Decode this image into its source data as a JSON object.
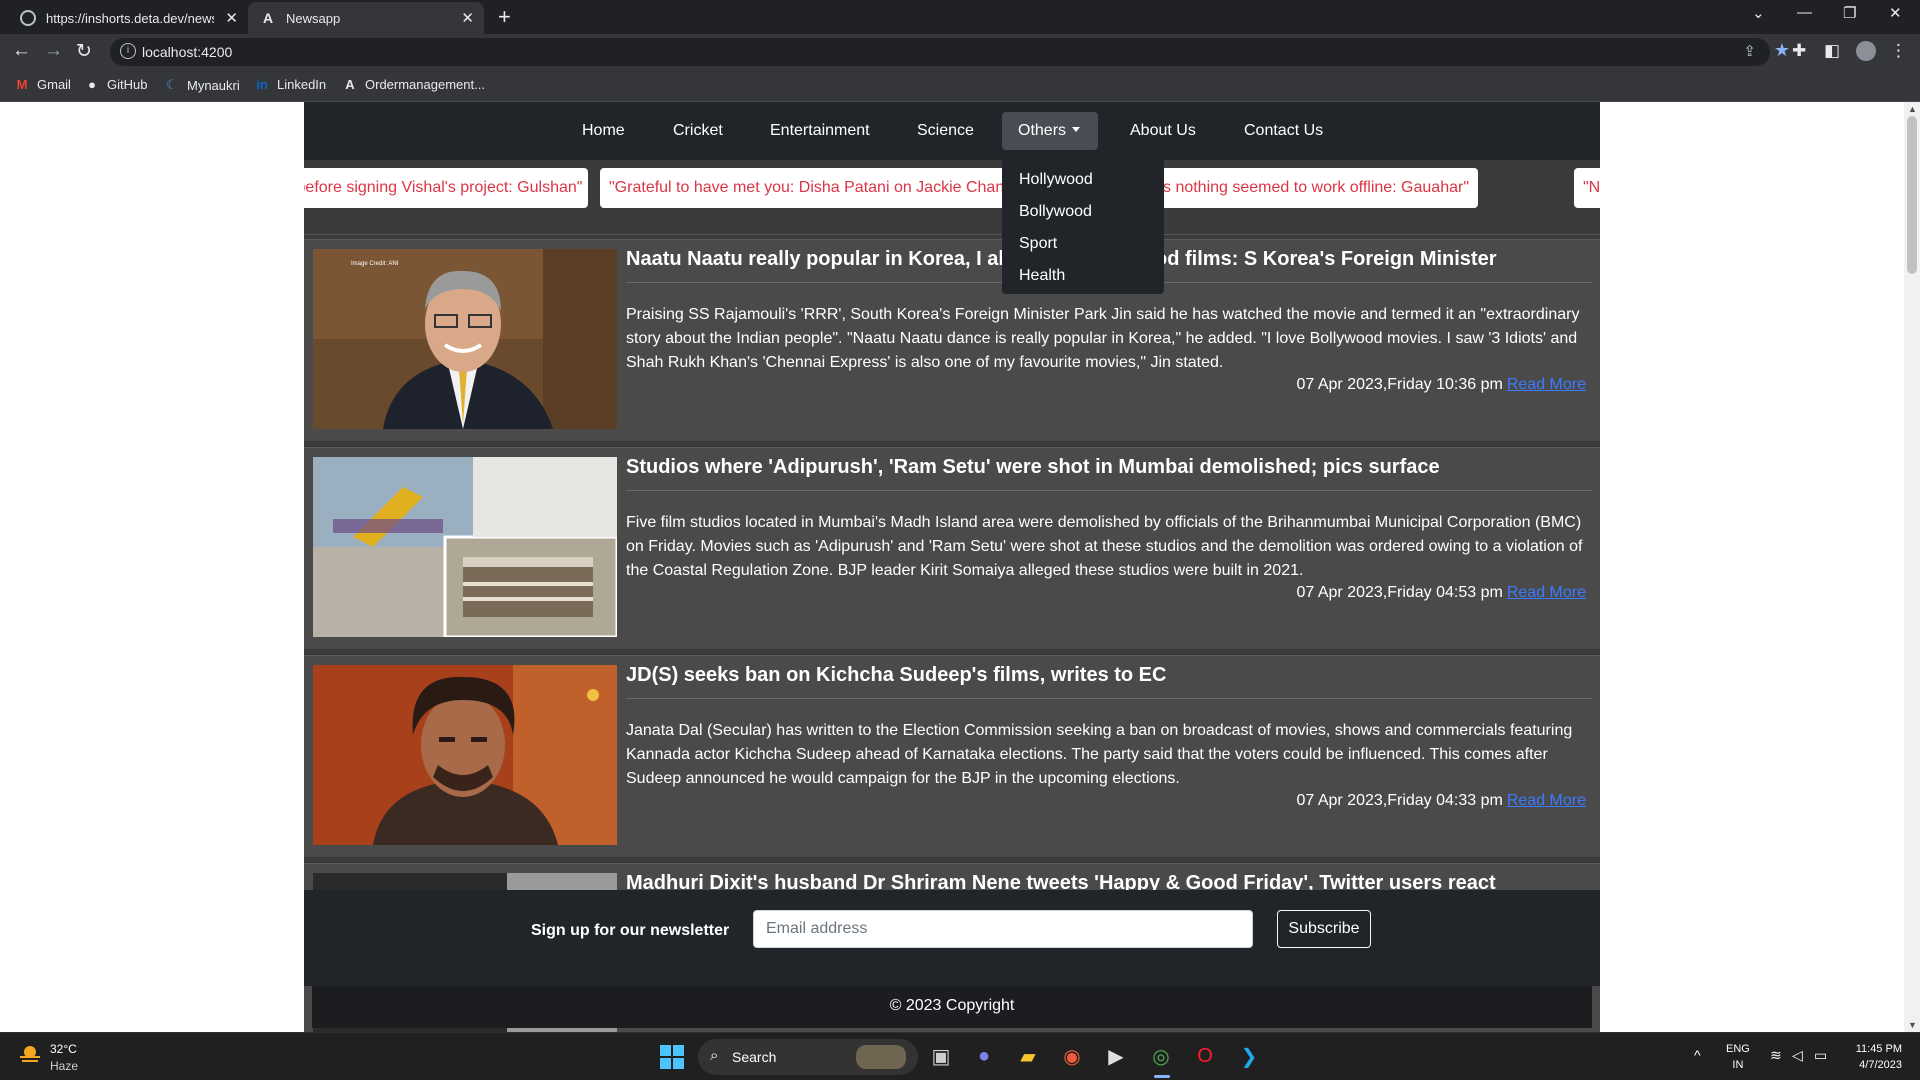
{
  "browser": {
    "tabs": [
      {
        "label": "https://inshorts.deta.dev/news?category=",
        "active": false
      },
      {
        "label": "Newsapp",
        "active": true
      }
    ],
    "new_tab": "+",
    "address": "localhost:4200",
    "bookmarks": [
      {
        "label": "Gmail",
        "icon": "gmail-icon",
        "glyph": "M",
        "color": "#ea4335"
      },
      {
        "label": "GitHub",
        "icon": "github-icon",
        "glyph": "●",
        "color": "#ffffff"
      },
      {
        "label": "Mynaukri",
        "icon": "naukri-icon",
        "glyph": "☾",
        "color": "#4a90e2"
      },
      {
        "label": "LinkedIn",
        "icon": "linkedin-icon",
        "glyph": "in",
        "color": "#0a66c2"
      },
      {
        "label": "Ordermanagement...",
        "icon": "angular-icon",
        "glyph": "A",
        "color": "#ffffff"
      }
    ]
  },
  "navbar": {
    "links": [
      "Home",
      "Cricket",
      "Entertainment",
      "Science"
    ],
    "dropdown_label": "Others",
    "dropdown_items": [
      "Hollywood",
      "Bollywood",
      "Sport",
      "Health"
    ],
    "right_links": [
      "About Us",
      "Contact Us"
    ]
  },
  "ticker": [
    "\"Being scared before signing Vishal's project: Gulshan\"",
    "\"Grateful to have met you: Disha Patani on Jackie Chan's",
    "\"Found love online as nothing seemed to work offline: Gauahar\"",
    "\"N"
  ],
  "articles": [
    {
      "title": "Naatu Naatu really popular in Korea, I also love Bollywood films: S Korea's Foreign Minister",
      "description": "Praising SS Rajamouli's 'RRR', South Korea's Foreign Minister Park Jin said he has watched the movie and termed it an \"extraordinary story about the Indian people\". \"Naatu Naatu dance is really popular in Korea,\" he added. \"I love Bollywood movies. I saw '3 Idiots' and Shah Rukh Khan's 'Chennai Express' is also one of my favourite movies,\" Jin stated.",
      "date": "07 Apr 2023,Friday 10:36 pm",
      "image_credit": "Image Credit: ANI"
    },
    {
      "title": "Studios where 'Adipurush', 'Ram Setu' were shot in Mumbai demolished; pics surface",
      "description": "Five film studios located in Mumbai's Madh Island area were demolished by officials of the Brihanmumbai Municipal Corporation (BMC) on Friday. Movies such as 'Adipurush' and 'Ram Setu' were shot at these studios and the demolition was ordered owing to a violation of the Coastal Regulation Zone. BJP leader Kirit Somaiya alleged these studios were built in 2021.",
      "date": "07 Apr 2023,Friday 04:53 pm"
    },
    {
      "title": "JD(S) seeks ban on Kichcha Sudeep's films, writes to EC",
      "description": "Janata Dal (Secular) has written to the Election Commission seeking a ban on broadcast of movies, shows and commercials featuring Kannada actor Kichcha Sudeep ahead of Karnataka elections. The party said that the voters could be influenced. This comes after Sudeep announced he would campaign for the BJP in the upcoming elections.",
      "date": "07 Apr 2023,Friday 04:33 pm"
    },
    {
      "title": "Madhuri Dixit's husband Dr Shriram Nene tweets 'Happy & Good Friday', Twitter users react",
      "description": "",
      "date": ""
    }
  ],
  "read_more": "Read More",
  "newsletter": {
    "label": "Sign up for our newsletter",
    "placeholder": "Email address",
    "button": "Subscribe"
  },
  "copyright": "© 2023 Copyright",
  "taskbar": {
    "weather_temp": "32°C",
    "weather_desc": "Haze",
    "search_label": "Search",
    "lang_top": "ENG",
    "lang_bottom": "IN",
    "time": "11:45 PM",
    "date": "4/7/2023"
  },
  "colors": {
    "navbar": "#212529",
    "page_bg": "#3b3b3b",
    "card_bg": "#4a4a4a",
    "ticker_text": "#dc3545",
    "link": "#3d7bfd"
  }
}
